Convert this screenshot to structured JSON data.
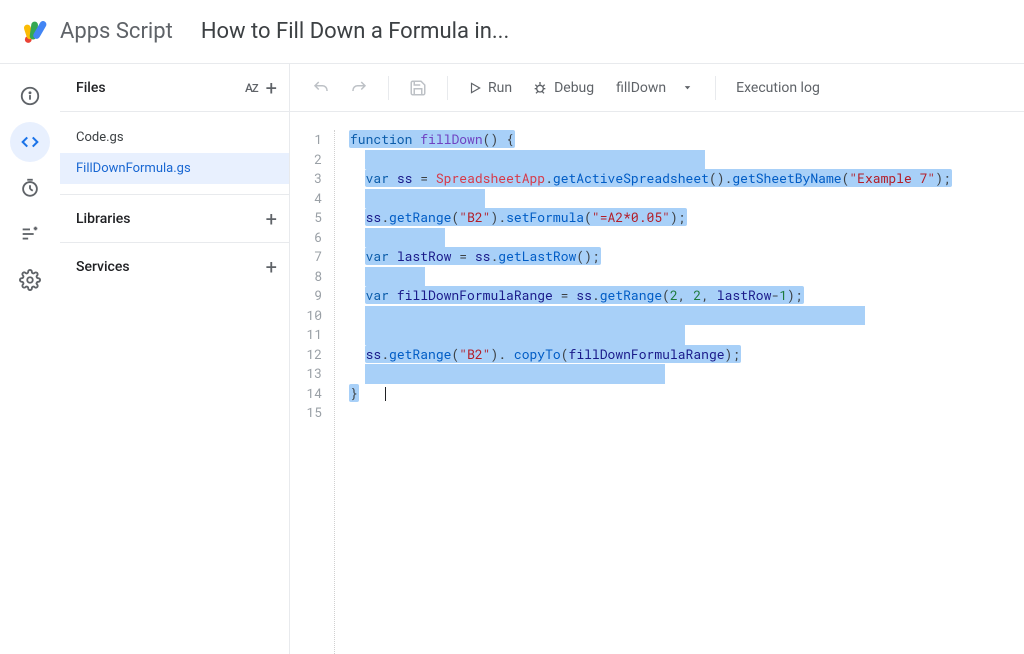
{
  "header": {
    "brand": "Apps Script",
    "project_title": "How to Fill Down a Formula in..."
  },
  "rail": {
    "items": [
      {
        "name": "info-icon"
      },
      {
        "name": "editor-icon"
      },
      {
        "name": "triggers-icon"
      },
      {
        "name": "executions-icon"
      },
      {
        "name": "settings-icon"
      }
    ]
  },
  "sidebar": {
    "files_label": "Files",
    "files": [
      {
        "name": "Code.gs",
        "selected": false
      },
      {
        "name": "FillDownFormula.gs",
        "selected": true
      }
    ],
    "libraries_label": "Libraries",
    "services_label": "Services"
  },
  "toolbar": {
    "run_label": "Run",
    "debug_label": "Debug",
    "function_selected": "fillDown",
    "exec_log_label": "Execution log"
  },
  "code": {
    "function_name": "fillDown",
    "sheet_name": "\"Example 7\"",
    "range_b2": "\"B2\"",
    "formula": "\"=A2*0.05\"",
    "args_2_2": "2",
    "args_2_2b": "2",
    "lastrow_minus": "1",
    "line_numbers": [
      "1",
      "2",
      "3",
      "4",
      "5",
      "6",
      "7",
      "8",
      "9",
      "10",
      "11",
      "12",
      "13",
      "14",
      "15"
    ]
  }
}
